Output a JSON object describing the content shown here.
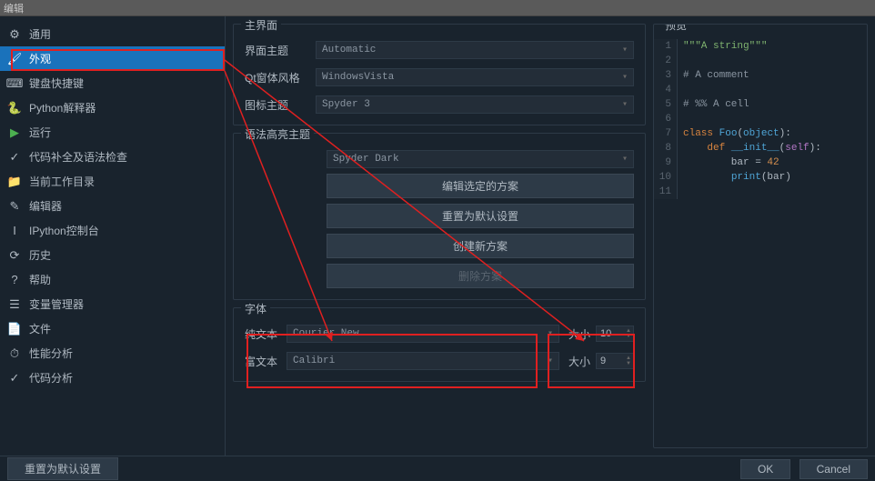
{
  "window": {
    "title": "编辑"
  },
  "sidebar": {
    "items": [
      {
        "icon": "⚙",
        "label": "通用"
      },
      {
        "icon": "🖌",
        "label": "外观",
        "selected": true
      },
      {
        "icon": "⌨",
        "label": "键盘快捷键"
      },
      {
        "icon": "🐍",
        "label": "Python解释器"
      },
      {
        "icon": "▶",
        "label": "运行",
        "color": "#4caf50"
      },
      {
        "icon": "✓",
        "label": "代码补全及语法检查"
      },
      {
        "icon": "📁",
        "label": "当前工作目录"
      },
      {
        "icon": "✎",
        "label": "编辑器"
      },
      {
        "icon": "I",
        "label": "IPython控制台"
      },
      {
        "icon": "⟳",
        "label": "历史"
      },
      {
        "icon": "?",
        "label": "帮助"
      },
      {
        "icon": "☰",
        "label": "变量管理器"
      },
      {
        "icon": "📄",
        "label": "文件"
      },
      {
        "icon": "⏱",
        "label": "性能分析"
      },
      {
        "icon": "✓",
        "label": "代码分析"
      }
    ]
  },
  "mainInterface": {
    "title": "主界面",
    "theme_label": "界面主题",
    "theme_value": "Automatic",
    "qt_label": "Qt窗体风格",
    "qt_value": "WindowsVista",
    "icon_label": "图标主题",
    "icon_value": "Spyder 3"
  },
  "syntax": {
    "title": "语法高亮主题",
    "scheme": "Spyder Dark",
    "edit": "编辑选定的方案",
    "reset": "重置为默认设置",
    "create": "创建新方案",
    "delete": "删除方案"
  },
  "font": {
    "title": "字体",
    "plain_label": "纯文本",
    "plain_value": "Courier New",
    "rich_label": "富文本",
    "rich_value": "Calibri",
    "size_label": "大小",
    "size1": "10",
    "size2": "9"
  },
  "preview": {
    "title": "预览"
  },
  "buttons": {
    "reset": "重置为默认设置",
    "ok": "OK",
    "cancel": "Cancel"
  }
}
